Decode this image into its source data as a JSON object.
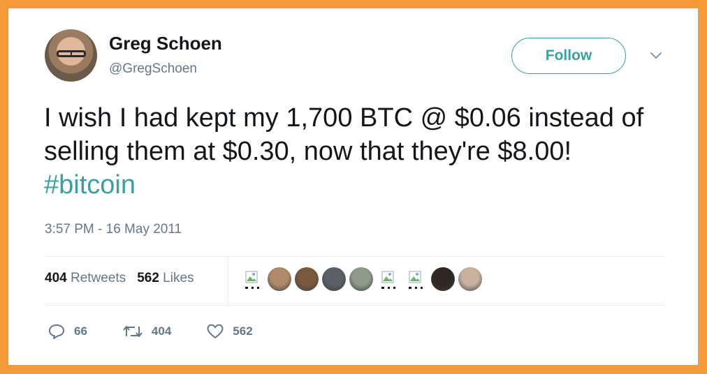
{
  "user": {
    "name": "Greg Schoen",
    "handle": "@GregSchoen"
  },
  "follow_label": "Follow",
  "tweet": {
    "text": "I wish I had kept my 1,700 BTC @ $0.06 instead of selling them at $0.30, now that they're $8.00! ",
    "hashtag": "#bitcoin",
    "timestamp": "3:57 PM - 16 May 2011"
  },
  "stats": {
    "retweets_count": "404",
    "retweets_label": "Retweets",
    "likes_count": "562",
    "likes_label": "Likes"
  },
  "likers": [
    {
      "kind": "broken-image"
    },
    {
      "kind": "photo",
      "color": "#b08a6a"
    },
    {
      "kind": "photo",
      "color": "#7a5a3e"
    },
    {
      "kind": "photo",
      "color": "#5a6068"
    },
    {
      "kind": "bitcoin-photo",
      "color": "#8f9a88"
    },
    {
      "kind": "broken-image"
    },
    {
      "kind": "broken-image"
    },
    {
      "kind": "photo",
      "color": "#2e2620"
    },
    {
      "kind": "photo",
      "color": "#c9b3a0"
    }
  ],
  "actions": {
    "replies": "66",
    "retweets": "404",
    "likes": "562"
  },
  "colors": {
    "frame": "#f29b38",
    "accent": "#38a1a2",
    "muted": "#657786"
  },
  "icons": [
    "chevron-down-icon",
    "reply-icon",
    "retweet-icon",
    "heart-icon",
    "broken-image-icon"
  ]
}
